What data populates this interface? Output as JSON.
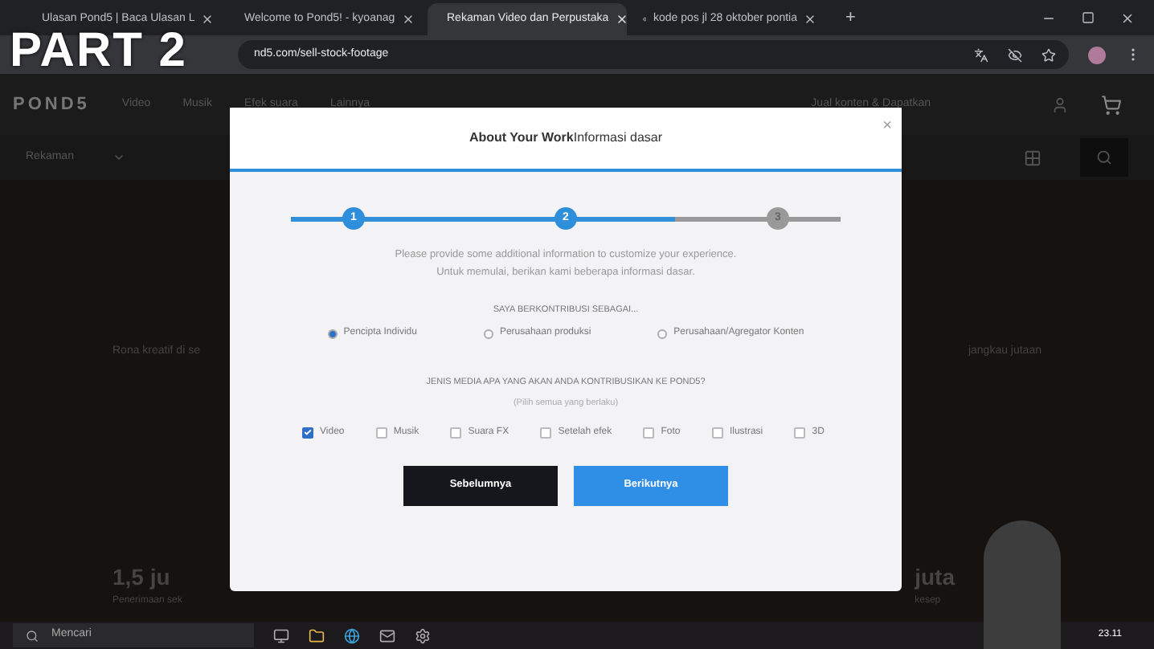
{
  "overlay_title": "PART 2",
  "browser": {
    "tabs": [
      {
        "label": "Ulasan Pond5 | Baca Ulasan L",
        "selected": false
      },
      {
        "label": "Welcome to Pond5! - kyoanag",
        "selected": false
      },
      {
        "label": "Rekaman Video dan Perpustaka",
        "selected": true
      },
      {
        "label": "kode pos jl 28 oktober pontia",
        "selected": false
      }
    ],
    "new_tab": "+",
    "address": "nd5.com/sell-stock-footage"
  },
  "site": {
    "logo": "POND5",
    "nav": [
      "Video",
      "Musik",
      "Efek suara",
      "Lainnya"
    ],
    "account_link": "Jual konten & Dapatkan",
    "search_category": "Rekaman",
    "hero_left": "Rona kreatif di se",
    "hero_right": "jangkau jutaan",
    "stat_left": "1,5 ju",
    "stat_left_caption": "Penerimaan sek",
    "stat_right": "juta",
    "stat_right_caption": "kesep"
  },
  "modal": {
    "title": "About Your Work",
    "title_overlap": "Informasi dasar",
    "close": "×",
    "steps": [
      {
        "label": "1",
        "reached": true
      },
      {
        "label": "2",
        "reached": true
      },
      {
        "label": "3",
        "reached": false
      }
    ],
    "progress": {
      "level": 0.7
    },
    "intro": [
      "Please provide some additional information to customize your experience.",
      "Untuk memulai, berikan kami beberapa informasi dasar."
    ],
    "role_question": "SAYA BERKONTRIBUSI SEBAGAI...",
    "roles": [
      {
        "label": "Pencipta Individu",
        "selected": true
      },
      {
        "label": "Perusahaan produksi",
        "selected": false
      },
      {
        "label": "Perusahaan/Agregator Konten",
        "selected": false
      }
    ],
    "media_question": "JENIS MEDIA APA YANG AKAN ANDA KONTRIBUSIKAN KE POND5?",
    "media_hint": "(Pilih semua yang berlaku)",
    "media": [
      {
        "label": "Video",
        "checked": true
      },
      {
        "label": "Musik",
        "checked": false
      },
      {
        "label": "Suara FX",
        "checked": false
      },
      {
        "label": "Setelah efek",
        "checked": false
      },
      {
        "label": "Foto",
        "checked": false
      },
      {
        "label": "Ilustrasi",
        "checked": false
      },
      {
        "label": "3D",
        "checked": false
      }
    ],
    "buttons": {
      "back": "Sebelumnya",
      "next": "Berikutnya"
    }
  },
  "taskbar": {
    "search": "Mencari",
    "time": "23.11"
  }
}
